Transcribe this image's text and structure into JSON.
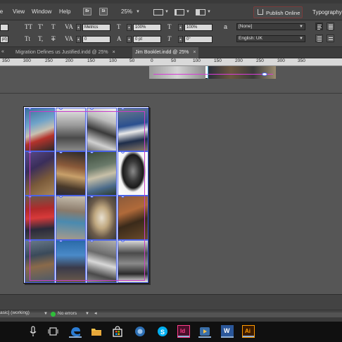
{
  "menu": {
    "items": [
      "le",
      "View",
      "Window",
      "Help"
    ]
  },
  "toolbar": {
    "bridge_label": "Br",
    "stock_label": "St",
    "zoom": "25%",
    "publish_label": "Publish Online",
    "workspace_label": "Typography"
  },
  "control": {
    "kerning_value": "Metrics",
    "tracking_value": "0",
    "vscale_value": "100%",
    "hscale_value": "100%",
    "baseline_value": "0 pt",
    "skew_value": "0°",
    "leading_value": "pt)",
    "char_style_value": "[None]",
    "language_value": "English: UK",
    "labels": {
      "tt_caps": "TT",
      "t_super": "T'",
      "t_small": "Tt",
      "t_sub": "T,",
      "va_kern": "VA",
      "va_track": "VA",
      "tt_vscale": "T",
      "tt_hscale": "T",
      "a_baseline": "A",
      "t_skew": "T",
      "a_char": "a"
    }
  },
  "tabs": [
    {
      "label": "Migration Defines us Justified.indd @ 25%",
      "active": false
    },
    {
      "label": "Jim Booklet.indd @ 25%",
      "active": true
    }
  ],
  "ruler": {
    "ticks": [
      "350",
      "300",
      "250",
      "200",
      "150",
      "100",
      "50",
      "0",
      "50",
      "100",
      "150",
      "200",
      "250",
      "300",
      "350"
    ]
  },
  "status": {
    "profile": "asic] (working)",
    "errors": "No errors"
  },
  "colors": {
    "accent_frame": "#4a62e6",
    "ok_green": "#2fbf3a",
    "indesign_pink": "#ff3c8a",
    "illustrator_orange": "#ff9a00"
  },
  "taskbar": {
    "icons": [
      "mic-icon",
      "task-view-icon",
      "edge-icon",
      "file-explorer-icon",
      "store-icon",
      "chrome-icon",
      "skype-icon",
      "indesign-icon",
      "media-player-icon",
      "word-icon",
      "illustrator-icon"
    ],
    "indesign_label": "Id",
    "word_label": "W",
    "illustrator_label": "Ai"
  }
}
